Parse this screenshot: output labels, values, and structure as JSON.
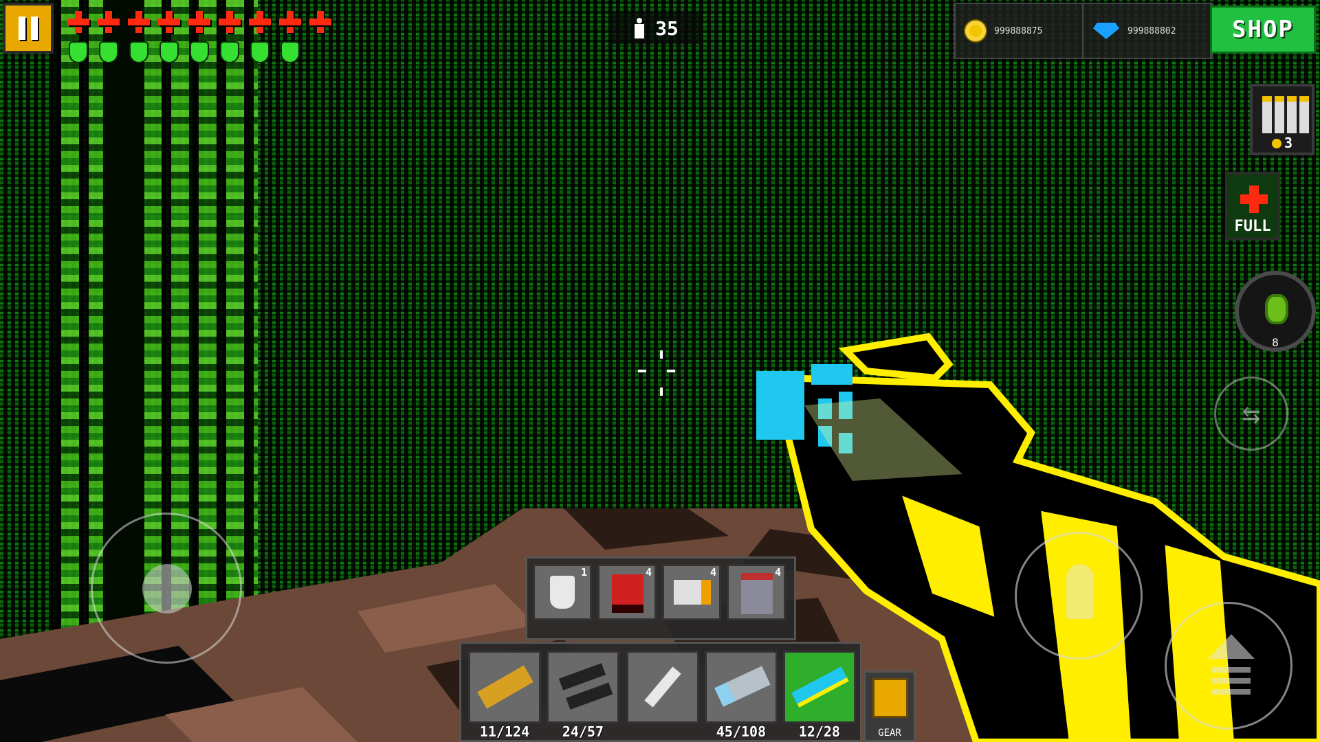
{
  "hud": {
    "pause_icon": "pause-icon",
    "health_hearts": 9,
    "armor_pieces": 8,
    "kills": "35",
    "coins": "999888875",
    "gems": "999888802",
    "shop_label": "SHOP",
    "ammo_price": "3",
    "medkit_label": "FULL",
    "grenades": "8"
  },
  "gadgets": [
    {
      "name": "potion",
      "count": "1"
    },
    {
      "name": "turret",
      "count": "4"
    },
    {
      "name": "jetpack",
      "count": "4"
    },
    {
      "name": "mech",
      "count": "4"
    }
  ],
  "weapons": [
    {
      "name": "golden-rifle",
      "ammo": "11/124",
      "selected": false
    },
    {
      "name": "dual-pistols",
      "ammo": "24/57",
      "selected": false
    },
    {
      "name": "knife",
      "ammo": "",
      "selected": false
    },
    {
      "name": "plasma-launcher",
      "ammo": "45/108",
      "selected": false
    },
    {
      "name": "laser-rifle",
      "ammo": "12/28",
      "selected": true
    }
  ],
  "gear_label": "GEAR",
  "colors": {
    "coin": "#f2c500",
    "gem": "#1aa0ff",
    "shop": "#22c040",
    "health": "#ff2a10",
    "armor": "#36e030",
    "gun_accent": "#ffee00"
  }
}
